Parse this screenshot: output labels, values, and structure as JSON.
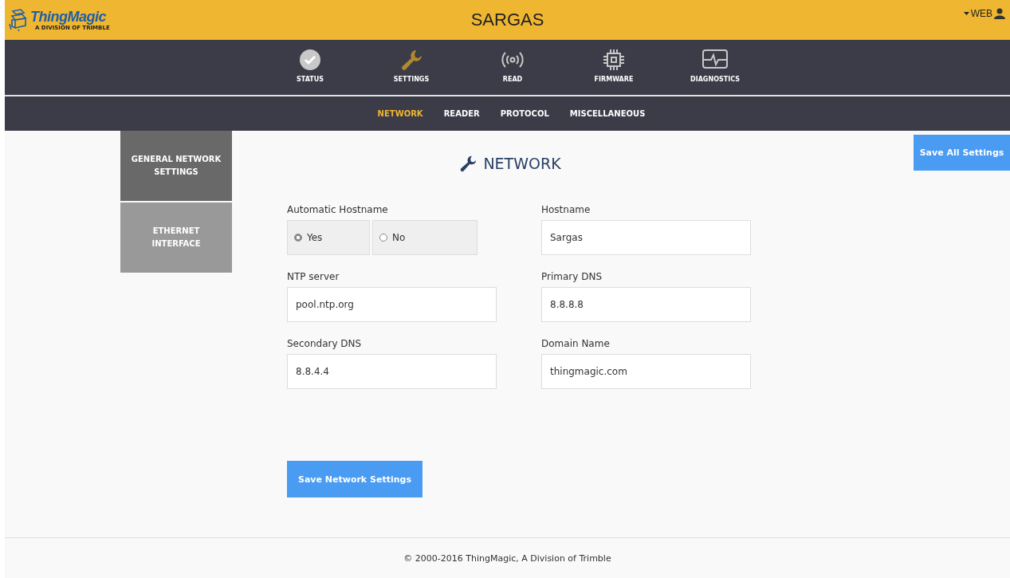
{
  "header": {
    "logo_name": "ThingMagic",
    "logo_tagline": "A DIVISION OF TRIMBLE",
    "title": "SARGAS",
    "user_menu": "WEB"
  },
  "main_nav": [
    {
      "label": "STATUS",
      "selected": false
    },
    {
      "label": "SETTINGS",
      "selected": true
    },
    {
      "label": "READ",
      "selected": false
    },
    {
      "label": "FIRMWARE",
      "selected": false
    },
    {
      "label": "DIAGNOSTICS",
      "selected": false
    }
  ],
  "sub_nav": [
    {
      "label": "NETWORK",
      "selected": true
    },
    {
      "label": "READER",
      "selected": false
    },
    {
      "label": "PROTOCOL",
      "selected": false
    },
    {
      "label": "MISCELLANEOUS",
      "selected": false
    }
  ],
  "sidebar": {
    "items": [
      {
        "label": "GENERAL NETWORK SETTINGS",
        "selected": true
      },
      {
        "label": "ETHERNET INTERFACE",
        "selected": false
      }
    ]
  },
  "save_all_button": "Save All Settings",
  "section_title": "NETWORK",
  "automatic_hostname": {
    "label": "Automatic Hostname",
    "options": [
      {
        "label": "Yes",
        "selected": true
      },
      {
        "label": "No",
        "selected": false
      }
    ]
  },
  "fields": [
    {
      "label": "Hostname",
      "value": "Sargas"
    },
    {
      "label": "NTP server",
      "value": "pool.ntp.org"
    },
    {
      "label": "Primary DNS",
      "value": "8.8.8.8"
    },
    {
      "label": "Secondary DNS",
      "value": "8.8.4.4"
    },
    {
      "label": "Domain Name",
      "value": "thingmagic.com"
    }
  ],
  "save_button": "Save Network Settings",
  "footer": "© 2000-2016 ThingMagic, A Division of Trimble"
}
